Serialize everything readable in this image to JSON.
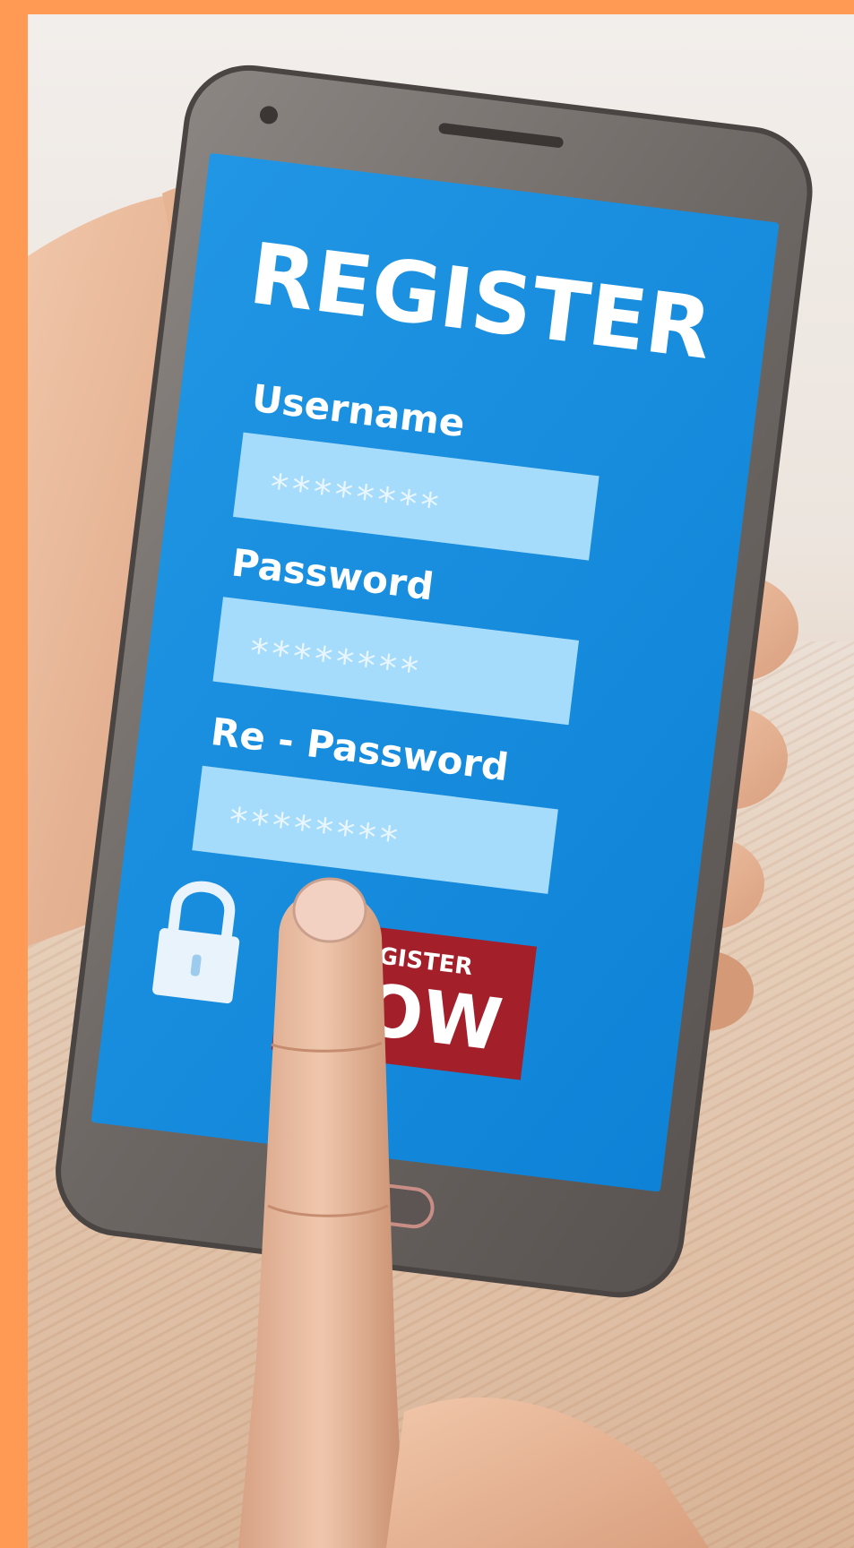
{
  "screen": {
    "title": "REGISTER",
    "fields": [
      {
        "label": "Username",
        "value": "********"
      },
      {
        "label": "Password",
        "value": "********"
      },
      {
        "label": "Re - Password",
        "value": "********"
      }
    ],
    "button": {
      "top": "REGISTER",
      "bottom": "NOW"
    }
  },
  "colors": {
    "frame": "#ff9a55",
    "screen": "#1a8fe0",
    "field": "#a6dcfb",
    "button": "#a3202b"
  },
  "icons": [
    "lock-icon"
  ]
}
